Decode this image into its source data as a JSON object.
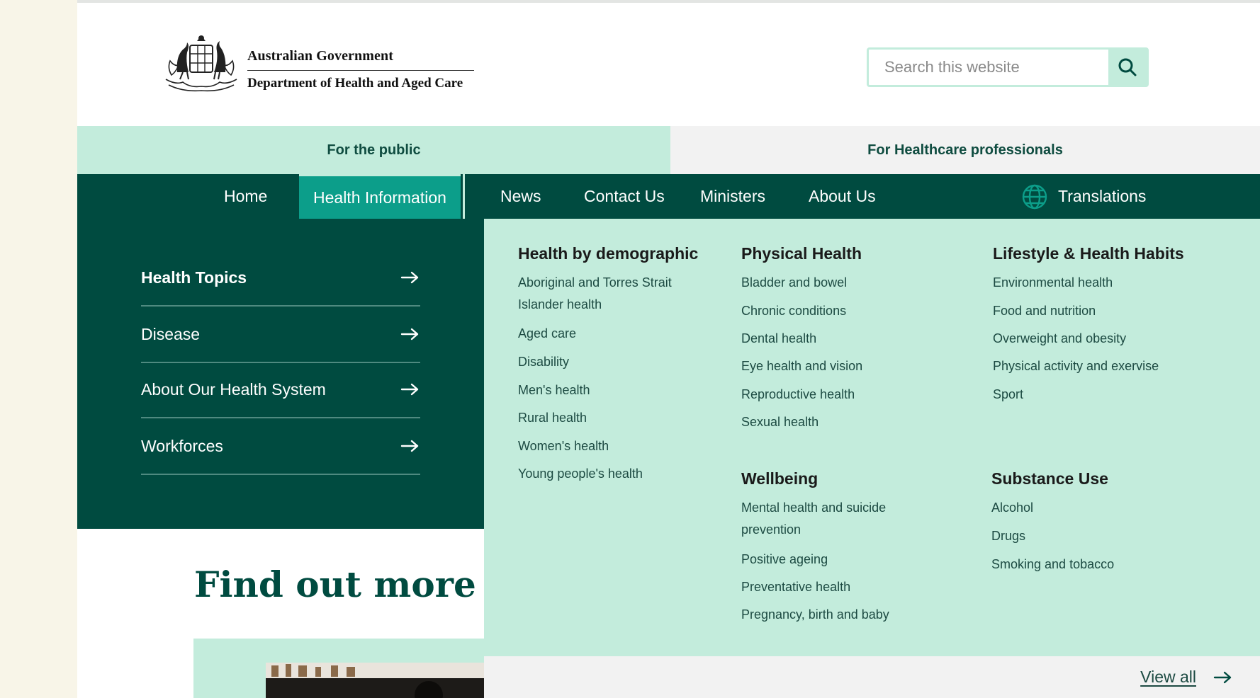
{
  "header": {
    "logo": {
      "government": "Australian Government",
      "department": "Department of Health and Aged Care"
    },
    "search": {
      "placeholder": "Search this website",
      "button_icon": "search-icon"
    }
  },
  "audience_tabs": {
    "public": "For the public",
    "professionals": "For Healthcare professionals"
  },
  "nav": {
    "items": [
      {
        "label": "Home"
      },
      {
        "label": "Health Information",
        "active": true
      },
      {
        "label": "News"
      },
      {
        "label": "Contact Us"
      },
      {
        "label": "Ministers"
      },
      {
        "label": "About Us"
      }
    ],
    "translations": {
      "label": "Translations",
      "icon": "globe-icon"
    }
  },
  "left_panel": {
    "items": [
      {
        "label": "Health Topics"
      },
      {
        "label": "Disease"
      },
      {
        "label": "About Our Health System"
      },
      {
        "label": "Workforces"
      }
    ]
  },
  "mega_menu": {
    "demographic": {
      "heading": "Health by demographic",
      "links": [
        "Aboriginal and Torres Strait",
        "Islander health",
        "Aged care",
        "Disability",
        "Men's health",
        "Rural health",
        "Women's health",
        "Young people's health"
      ]
    },
    "physical": {
      "heading": "Physical Health",
      "links": [
        "Bladder and bowel",
        "Chronic conditions",
        "Dental health",
        "Eye health and vision",
        "Reproductive health",
        "Sexual health"
      ]
    },
    "wellbeing": {
      "heading": "Wellbeing",
      "links": [
        "Mental health and suicide",
        "prevention",
        "Positive ageing",
        "Preventative health",
        "Pregnancy, birth and baby"
      ]
    },
    "lifestyle": {
      "heading": "Lifestyle & Health Habits",
      "links": [
        "Environmental health",
        "Food and nutrition",
        "Overweight and obesity",
        "Physical activity and exervise",
        "Sport"
      ]
    },
    "substance": {
      "heading": "Substance Use",
      "links": [
        "Alcohol",
        "Drugs",
        "Smoking and tobacco"
      ]
    },
    "view_all": "View all"
  },
  "content": {
    "heading_fragment": "Find out more abo"
  },
  "colors": {
    "dark_green": "#004b40",
    "mint": "#c3ecdc",
    "teal_active": "#0c9e8a",
    "side_cream": "#f8f5e8"
  }
}
